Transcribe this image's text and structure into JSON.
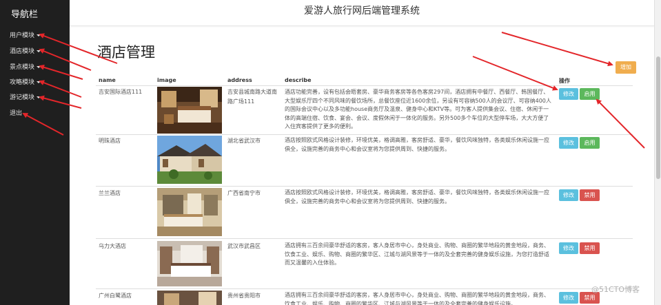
{
  "sidebar": {
    "title": "导航栏",
    "items": [
      {
        "label": "用户模块",
        "caret": true
      },
      {
        "label": "酒店模块",
        "caret": true
      },
      {
        "label": "景点模块",
        "caret": true
      },
      {
        "label": "攻略模块",
        "caret": true
      },
      {
        "label": "游记模块",
        "caret": true
      },
      {
        "label": "退出",
        "caret": false
      }
    ]
  },
  "header": {
    "title": "爱游人旅行网后端管理系统"
  },
  "page": {
    "title": "酒店管理",
    "add_label": "增加"
  },
  "table": {
    "columns": [
      "name",
      "image",
      "address",
      "describe",
      "操作"
    ],
    "rows": [
      {
        "name": "吉安国际酒店111",
        "address": "吉安县城南路大道南路广场111",
        "describe": "酒店功能完善，设有包括会晤套房、豪华商务客房等各色客房297间，酒店拥有中餐厅、西餐厅、韩国餐厅、大型娱乐厅四个不同风味的餐饮场所，总餐饮座位近1600余位，另设有可容纳500人的会议厅、可容纳400人的国际会议中心以及多功能house商务厅及温泉、健身中心和KTV等。可为客人提供集会议、住宿、休闲于一体的高端住宿、饮食、宴会、会议、度假休闲于一体化的服务。另外500多个车位的大型停车场，大大方便了入住宾客提供了更多的便利。",
        "edit_label": "修改",
        "status_label": "启用",
        "status_type": "enable"
      },
      {
        "name": "明珠酒店",
        "address": "湖北省武汉市",
        "describe": "酒店按照欧式风格设计装修，环境优美，格调高雅，客房舒适、豪华，餐饮风味独特，各类娱乐休闲设施一应俱全，设施完善的商务中心和会议室将为您提供周到、快捷的服务。",
        "edit_label": "修改",
        "status_label": "启用",
        "status_type": "enable"
      },
      {
        "name": "兰兰酒店",
        "address": "广西省南宁市",
        "describe": "酒店按照欧式风格设计装修，环境优美，格调高雅，客房舒适、豪华，餐饮风味独特，各类娱乐休闲设施一应俱全，设施完善的商务中心和会议室将为您提供周到、快捷的服务。",
        "edit_label": "修改",
        "status_label": "禁用",
        "status_type": "disable"
      },
      {
        "name": "乌力大酒店",
        "address": "武汉市武昌区",
        "describe": "酒店拥有三百余间豪华舒适的客房，客人身居市中心，身处商业、购物、商圈的繁华地段的黄金地段，商务、饮食工业、娱乐、购物、商圈的繁华区、江城与湖风景等于一体的及全套完善的健身娱乐设施，为您打造舒适而又温馨的入住体验。",
        "edit_label": "修改",
        "status_label": "禁用",
        "status_type": "disable"
      },
      {
        "name": "广州白鹭酒店",
        "address": "贵州省贵阳市",
        "describe": "酒店拥有三百余间豪华舒适的客房，客人身居市中心，身处商业、购物、商圈的繁华地段的黄金地段，商务、饮食工业、娱乐、购物、商圈的繁华区、江城与湖风景等于一体的及全套完善的健身娱乐设施。",
        "edit_label": "修改",
        "status_label": "禁用",
        "status_type": "disable"
      }
    ]
  },
  "watermark": "@51CTO博客",
  "colors": {
    "sidebar_bg": "#1f1f1f",
    "edit": "#5bc0de",
    "enable": "#5cb85c",
    "disable": "#d9534f",
    "add": "#f0ad4e",
    "arrow": "#e3262a"
  }
}
